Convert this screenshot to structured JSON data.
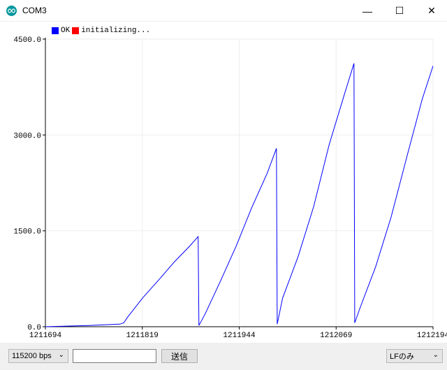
{
  "window": {
    "title": "COM3",
    "minimize_glyph": "—",
    "maximize_glyph": "☐",
    "close_glyph": "✕"
  },
  "legend": [
    {
      "label": "OK",
      "color": "#0000ff"
    },
    {
      "label": "initializing...",
      "color": "#ff0000"
    }
  ],
  "chart_data": {
    "type": "line",
    "xlim": [
      1211694,
      1212194
    ],
    "ylim": [
      0,
      4500
    ],
    "x_ticks": [
      "1211694",
      "1211819",
      "1211944",
      "1212069",
      "1212194"
    ],
    "y_ticks": [
      "0.0",
      "1500.0",
      "3000.0",
      "4500.0"
    ],
    "grid": true,
    "series": [
      {
        "name": "OK",
        "color": "#0000ff",
        "points": [
          [
            1211694,
            0
          ],
          [
            1211750,
            20
          ],
          [
            1211790,
            40
          ],
          [
            1211795,
            60
          ],
          [
            1211800,
            150
          ],
          [
            1211820,
            460
          ],
          [
            1211840,
            730
          ],
          [
            1211860,
            1010
          ],
          [
            1211880,
            1260
          ],
          [
            1211891,
            1410
          ],
          [
            1211892,
            20
          ],
          [
            1211900,
            200
          ],
          [
            1211920,
            720
          ],
          [
            1211940,
            1260
          ],
          [
            1211960,
            1860
          ],
          [
            1211980,
            2400
          ],
          [
            1211992,
            2790
          ],
          [
            1211993,
            40
          ],
          [
            1212000,
            450
          ],
          [
            1212020,
            1100
          ],
          [
            1212040,
            1880
          ],
          [
            1212060,
            2850
          ],
          [
            1212080,
            3650
          ],
          [
            1212092,
            4120
          ],
          [
            1212093,
            60
          ],
          [
            1212100,
            300
          ],
          [
            1212120,
            940
          ],
          [
            1212140,
            1720
          ],
          [
            1212160,
            2650
          ],
          [
            1212180,
            3560
          ],
          [
            1212194,
            4080
          ]
        ]
      },
      {
        "name": "initializing...",
        "color": "#ff0000",
        "points": []
      }
    ]
  },
  "bottombar": {
    "baud": "115200 bps",
    "send_value": "",
    "send_label": "送信",
    "line_ending": "LFのみ"
  }
}
